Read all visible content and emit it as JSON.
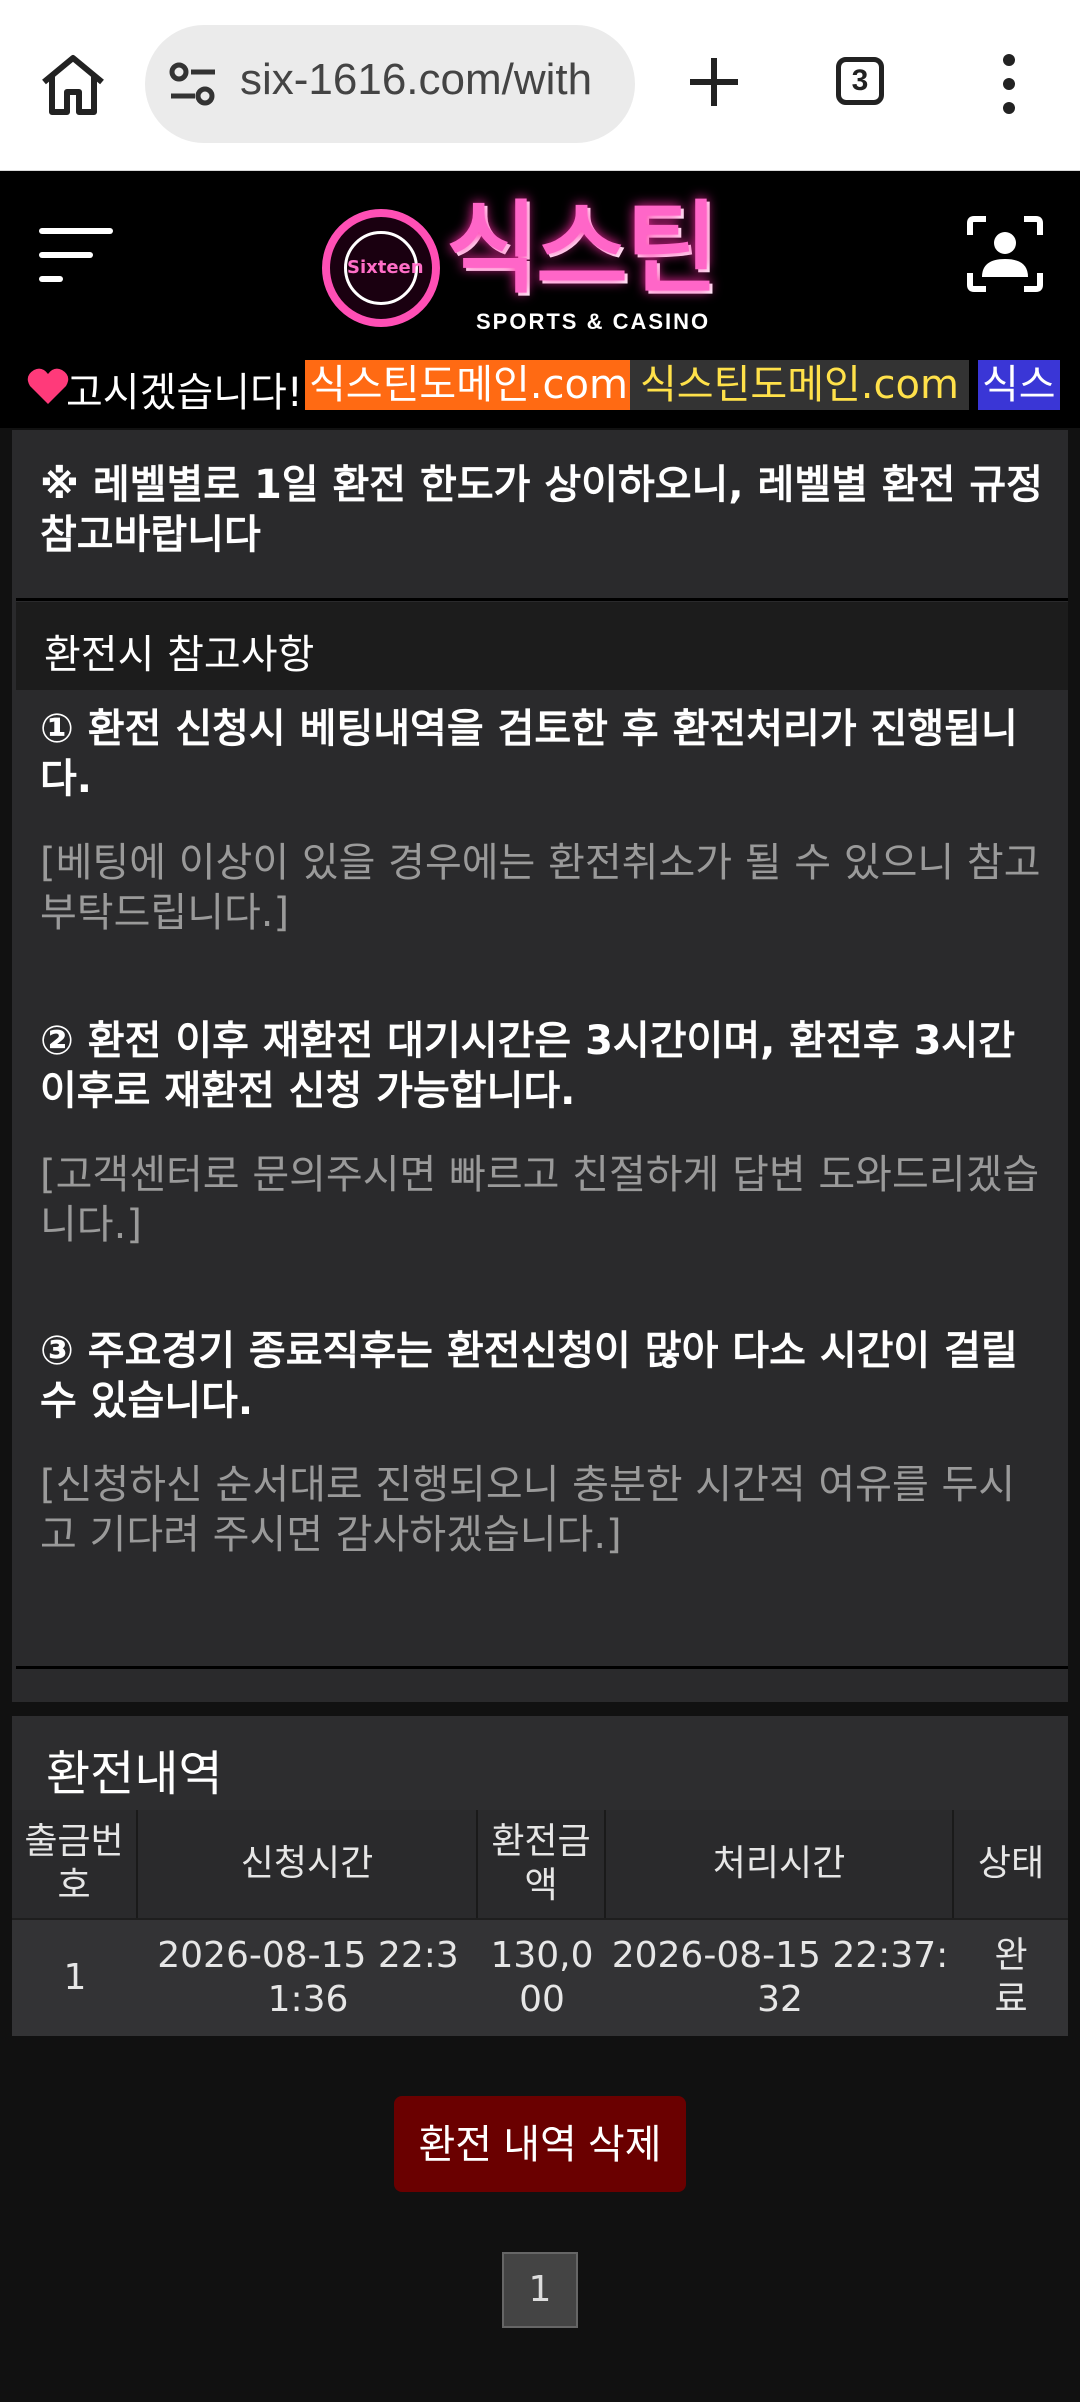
{
  "browser": {
    "url": "six-1616.com/with",
    "tab_count": "3"
  },
  "site": {
    "logo_text": "식스틴",
    "logo_badge": "Sixteen",
    "logo_sub": "SPORTS & CASINO"
  },
  "marquee": {
    "text": "고시겠습니다!",
    "chip1": "식스틴도메인.com",
    "chip2": "식스틴도메인.com",
    "chip3": "식스"
  },
  "notice": {
    "top_text": "※ 레벨별로 1일 환전 한도가 상이하오니, 레벨별 환전 규정 참고바랍니다",
    "ref_title": "환전시 참고사항",
    "items": [
      {
        "head": "① 환전 신청시 베팅내역을 검토한 후 환전처리가 진행됩니다.",
        "sub": "[베팅에 이상이 있을 경우에는 환전취소가 될 수 있으니 참고 부탁드립니다.]"
      },
      {
        "head": "② 환전 이후 재환전 대기시간은 3시간이며, 환전후 3시간 이후로 재환전 신청 가능합니다.",
        "sub": "[고객센터로 문의주시면 빠르고 친절하게 답변 도와드리겠습니다.]"
      },
      {
        "head": "③ 주요경기 종료직후는 환전신청이 많아 다소 시간이 걸릴 수 있습니다.",
        "sub": "[신청하신 순서대로 진행되오니 충분한 시간적 여유를 두시고 기다려 주시면 감사하겠습니다.]"
      }
    ]
  },
  "history": {
    "title": "환전내역",
    "columns": [
      "출금번호",
      "신청시간",
      "환전금액",
      "처리시간",
      "상태"
    ],
    "rows": [
      [
        "1",
        "2026-08-15 22:31:36",
        "130,000",
        "2026-08-15 22:37:32",
        "완료"
      ]
    ],
    "delete_label": "환전 내역 삭제",
    "page": "1"
  }
}
